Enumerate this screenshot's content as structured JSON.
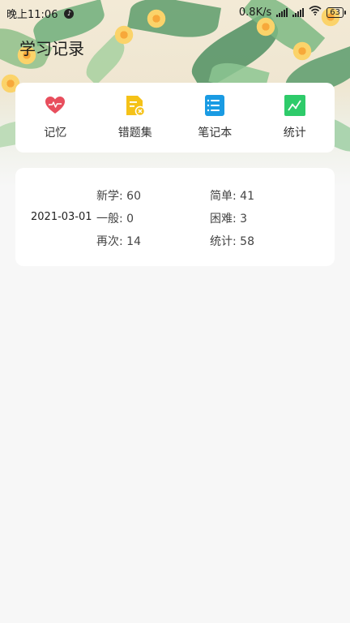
{
  "status_bar": {
    "time": "晚上11:06",
    "net_speed": "0.8K/s",
    "battery": "63"
  },
  "page": {
    "title": "学习记录"
  },
  "nav": {
    "items": [
      {
        "label": "记忆",
        "icon": "heart-pulse-icon",
        "color": "#e84e5d"
      },
      {
        "label": "错题集",
        "icon": "wrong-doc-icon",
        "color": "#f5c218"
      },
      {
        "label": "笔记本",
        "icon": "notebook-icon",
        "color": "#1a9be3"
      },
      {
        "label": "统计",
        "icon": "chart-icon",
        "color": "#2ecb6a"
      }
    ]
  },
  "record": {
    "date": "2021-03-01",
    "stats": {
      "new": "新学: 60",
      "easy": "简单: 41",
      "normal": "一般: 0",
      "hard": "困难: 3",
      "again": "再次: 14",
      "total": "统计: 58"
    }
  }
}
